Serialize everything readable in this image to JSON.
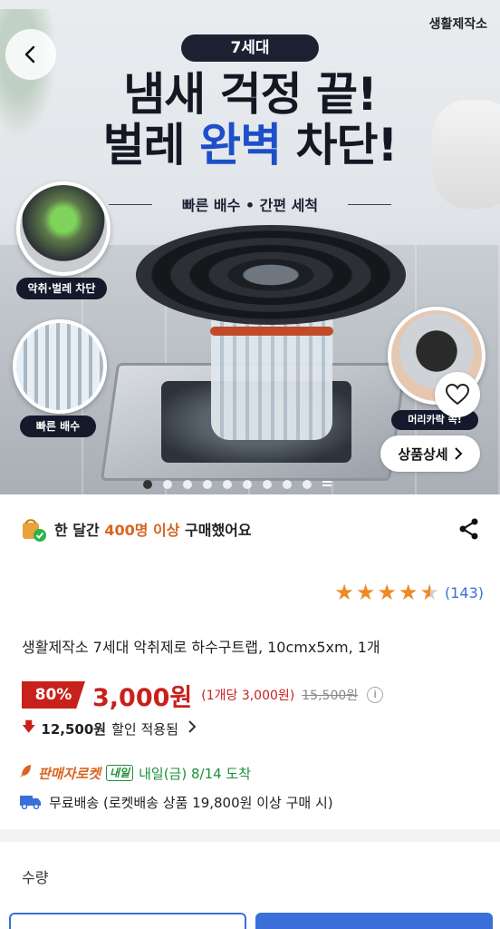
{
  "hero": {
    "brand": "생활제작소",
    "generation_badge": "7세대",
    "headline_line1": "냄새 걱정 끝!",
    "headline_line2_dark_a": "벌레 ",
    "headline_line2_blue": "완벽",
    "headline_line2_dark_b": " 차단!",
    "subtitle": "빠른 배수 • 간편 세척",
    "feature_labels": [
      "악취·벌레 차단",
      "빠른 배수",
      "머리카락 쏙!"
    ],
    "detail_button_label": "상품상세",
    "carousel": {
      "total": 10,
      "active_index": 0
    },
    "icons": {
      "back": "back-chevron-icon",
      "heart": "heart-icon",
      "detail_arrow": "chevron-right-icon"
    }
  },
  "purchase_info": {
    "prefix": "한 달간 ",
    "highlight": "400명 이상",
    "suffix": " 구매했어요",
    "highlight_color": "#d9641f"
  },
  "rating": {
    "stars": 4.5,
    "count": "(143)"
  },
  "product": {
    "title": "생활제작소 7세대 악취제로 하수구트랩, 10cmx5xm, 1개"
  },
  "price": {
    "discount": "80%",
    "sale_price": "3,000원",
    "unit_price": "(1개당 3,000원)",
    "original_price": "15,500원",
    "accent_color": "#c8211b"
  },
  "savings": {
    "amount": "12,500원",
    "text": "할인 적용됨"
  },
  "delivery": {
    "rocket_label": "판매자로켓",
    "tomorrow_badge": "내일",
    "date": "내일(금) 8/14 도착"
  },
  "shipping": {
    "text": "무료배송 (로켓배송 상품 19,800원 이상 구매 시)"
  },
  "quantity": {
    "label": "수량"
  }
}
